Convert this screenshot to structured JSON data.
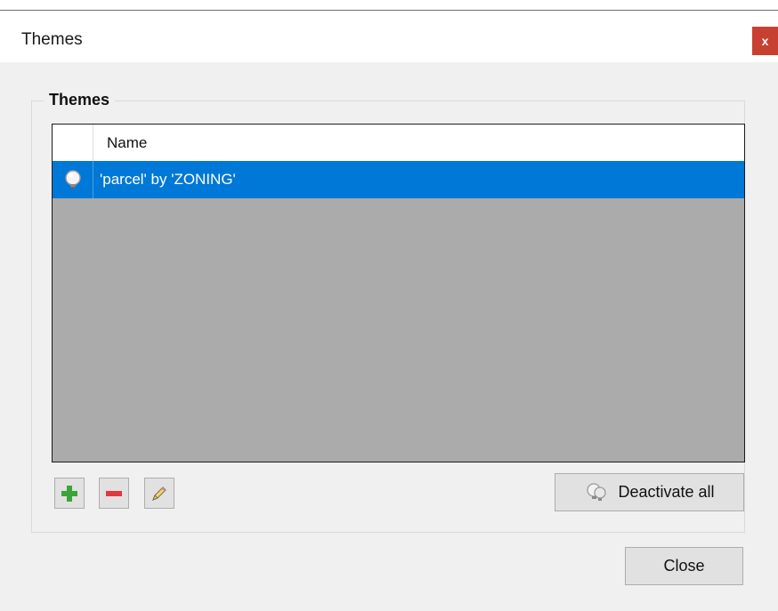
{
  "window": {
    "title": "Themes",
    "close_glyph": "x"
  },
  "group": {
    "legend": "Themes"
  },
  "list": {
    "column_header": "Name",
    "rows": [
      {
        "icon": "lightbulb-icon",
        "name": "'parcel' by 'ZONING'",
        "selected": true
      }
    ]
  },
  "toolbar": {
    "add_icon": "plus-icon",
    "remove_icon": "minus-icon",
    "edit_icon": "pencil-icon",
    "deactivate_icon": "lightbulbs-icon",
    "deactivate_label": "Deactivate all"
  },
  "footer": {
    "close_label": "Close"
  },
  "colors": {
    "selection": "#0078d7",
    "close_button": "#c84031",
    "add": "#3aa43a",
    "remove": "#e0383e"
  }
}
